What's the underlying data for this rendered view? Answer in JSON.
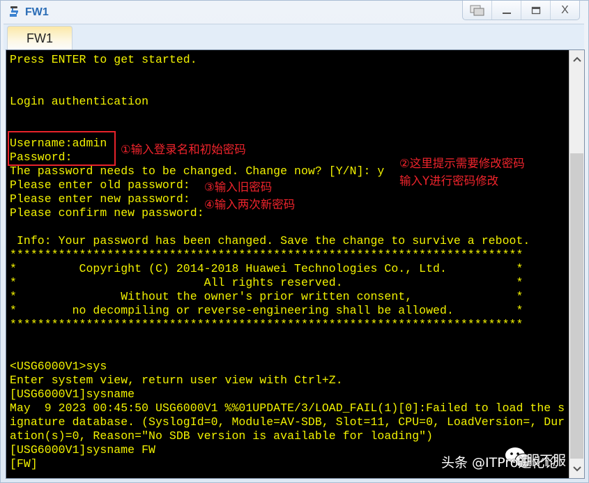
{
  "window": {
    "title": "FW1",
    "app_icon": "network-device-icon",
    "controls": [
      {
        "name": "restore-windows-button",
        "icon": "restore-icon",
        "glyph": "❐"
      },
      {
        "name": "minimize-button",
        "icon": "minimize-icon",
        "glyph": "—"
      },
      {
        "name": "maximize-button",
        "icon": "maximize-icon",
        "glyph": "▭"
      },
      {
        "name": "close-button",
        "icon": "close-icon",
        "glyph": "X"
      }
    ]
  },
  "tabs": [
    {
      "label": "FW1",
      "active": true
    }
  ],
  "terminal": {
    "background": "#000000",
    "text_color": "#f2f200",
    "lines": [
      "Press ENTER to get started.",
      "",
      "",
      "Login authentication",
      "",
      "",
      "Username:admin",
      "Password:",
      "The password needs to be changed. Change now? [Y/N]: y",
      "Please enter old password:",
      "Please enter new password:",
      "Please confirm new password:",
      "",
      " Info: Your password has been changed. Save the change to survive a reboot.",
      "**************************************************************************",
      "*         Copyright (C) 2014-2018 Huawei Technologies Co., Ltd.          *",
      "*                           All rights reserved.                         *",
      "*               Without the owner's prior written consent,               *",
      "*        no decompiling or reverse-engineering shall be allowed.         *",
      "**************************************************************************",
      "",
      "",
      "<USG6000V1>sys",
      "Enter system view, return user view with Ctrl+Z.",
      "[USG6000V1]sysname",
      "May  9 2023 00:45:50 USG6000V1 %%01UPDATE/3/LOAD_FAIL(1)[0]:Failed to load the s",
      "ignature database. (SyslogId=0, Module=AV-SDB, Slot=11, CPU=0, LoadVersion=, Dur",
      "ation(s)=0, Reason=\"No SDB version is available for loading\")",
      "[USG6000V1]sysname FW",
      "[FW]"
    ]
  },
  "scrollbar": {
    "up_icon": "chevron-up-icon",
    "down_icon": "chevron-down-icon",
    "up_glyph": "^",
    "down_glyph": "v",
    "position": "bottom"
  },
  "annotations": {
    "color": "#f0242c",
    "step1": "①输入登录名和初始密码",
    "step2_line1": "②这里提示需要修改密码",
    "step2_line2": "输入Y进行密码修改",
    "step3": "③输入旧密码",
    "step4": "④输入两次新密码"
  },
  "watermark": {
    "text": "头条 @ITPro进化论",
    "overlay_text": "服不服",
    "icon": "wechat-icon"
  }
}
